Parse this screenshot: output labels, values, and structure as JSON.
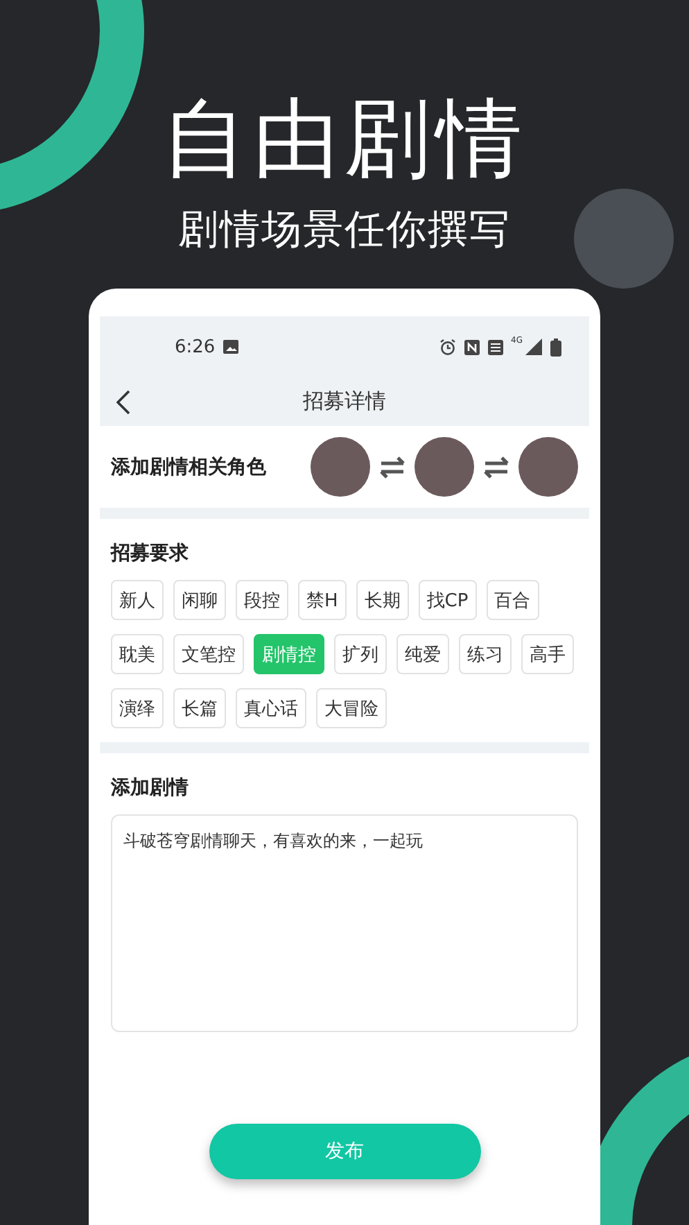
{
  "headline": "自由剧情",
  "subheadline": "剧情场景任你撰写",
  "status_bar": {
    "time": "6:26",
    "network": "4G"
  },
  "header": {
    "title": "招募详情"
  },
  "roles": {
    "label": "添加剧情相关角色"
  },
  "requirements": {
    "title": "招募要求",
    "tag_rows": [
      [
        {
          "label": "新人",
          "selected": false
        },
        {
          "label": "闲聊",
          "selected": false
        },
        {
          "label": "段控",
          "selected": false
        },
        {
          "label": "禁H",
          "selected": false
        },
        {
          "label": "长期",
          "selected": false
        },
        {
          "label": "找CP",
          "selected": false
        },
        {
          "label": "百合",
          "selected": false
        }
      ],
      [
        {
          "label": "耽美",
          "selected": false
        },
        {
          "label": "文笔控",
          "selected": false
        },
        {
          "label": "剧情控",
          "selected": true
        },
        {
          "label": "扩列",
          "selected": false
        },
        {
          "label": "纯爱",
          "selected": false
        },
        {
          "label": "练习",
          "selected": false
        },
        {
          "label": "高手",
          "selected": false
        }
      ],
      [
        {
          "label": "演绎",
          "selected": false
        },
        {
          "label": "长篇",
          "selected": false
        },
        {
          "label": "真心话",
          "selected": false
        },
        {
          "label": "大冒险",
          "selected": false
        }
      ]
    ]
  },
  "plot": {
    "title": "添加剧情",
    "value": "斗破苍穹剧情聊天，有喜欢的来，一起玩"
  },
  "submit_button": "发布"
}
